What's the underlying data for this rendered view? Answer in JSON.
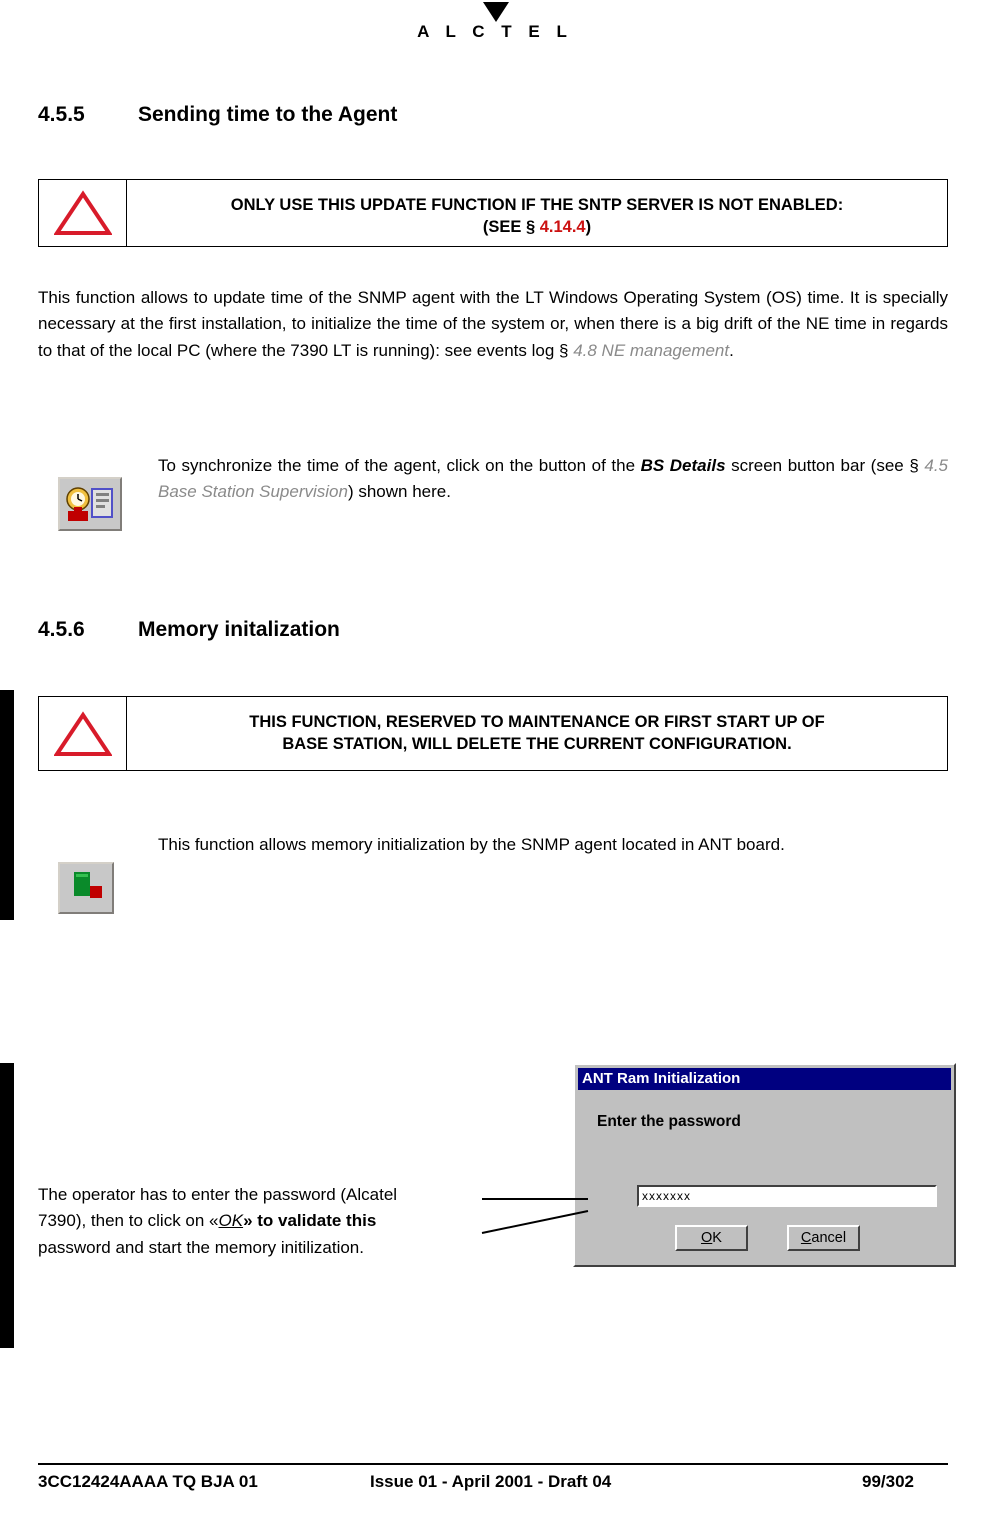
{
  "header": {
    "logo_text": "A L C  T E L",
    "logo_icon": "alcatel-triangle-logo"
  },
  "sections": [
    {
      "number": "4.5.5",
      "title": "Sending time to the Agent"
    },
    {
      "number": "4.5.6",
      "title": "Memory initalization"
    }
  ],
  "warnings": [
    {
      "icon": "warning-triangle-icon",
      "line1": "ONLY USE THIS UPDATE FUNCTION IF THE SNTP SERVER IS NOT ENABLED:",
      "line2_prefix": "(SEE § ",
      "line2_ref": "4.14.4",
      "line2_suffix": ")"
    },
    {
      "icon": "warning-triangle-icon",
      "line1": "THIS FUNCTION, RESERVED TO MAINTENANCE OR FIRST START UP OF",
      "line2": "BASE STATION, WILL DELETE THE CURRENT CONFIGURATION."
    }
  ],
  "paragraphs": {
    "intro_1": "This function allows to update time of the SNMP agent with the LT Windows Operating System (OS) time. It is specially necessary at the first installation, to initialize the time of the system or, when there is a big drift of the NE time in regards to that of the local PC (where the 7390 LT is running): see events log § ",
    "intro_1_ref": "4.8 NE management",
    "intro_1_end": ".",
    "sync_part1": "To synchronize the time of the agent, click on the button of the ",
    "sync_bold": "BS Details",
    "sync_part2": " screen button bar (see § ",
    "sync_ref": "4.5 Base Station Supervision",
    "sync_part3": ") shown here.",
    "memory_init": "This function allows memory initialization by the SNMP agent located in ANT board."
  },
  "icons": {
    "clock_tool": "bs-details-time-button-icon",
    "memory_tool": "memory-initialization-button-icon"
  },
  "dialog": {
    "title": "ANT Ram Initialization",
    "label": "Enter the password",
    "password_value": "xxxxxxx",
    "ok_label": "OK",
    "ok_accel": "O",
    "cancel_label": "Cancel",
    "cancel_accel": "C"
  },
  "callout": {
    "line1": "The operator has to enter the password (Alcatel",
    "line2_a": "7390), then to click on «",
    "line2_ital": "OK",
    "line2_b": "» to validate this",
    "line3": "password and start the memory initilization."
  },
  "footer": {
    "left": "3CC12424AAAA TQ BJA 01",
    "center": "Issue 01 - April 2001 - Draft 04",
    "right_page": "99",
    "right_total": "/302"
  }
}
